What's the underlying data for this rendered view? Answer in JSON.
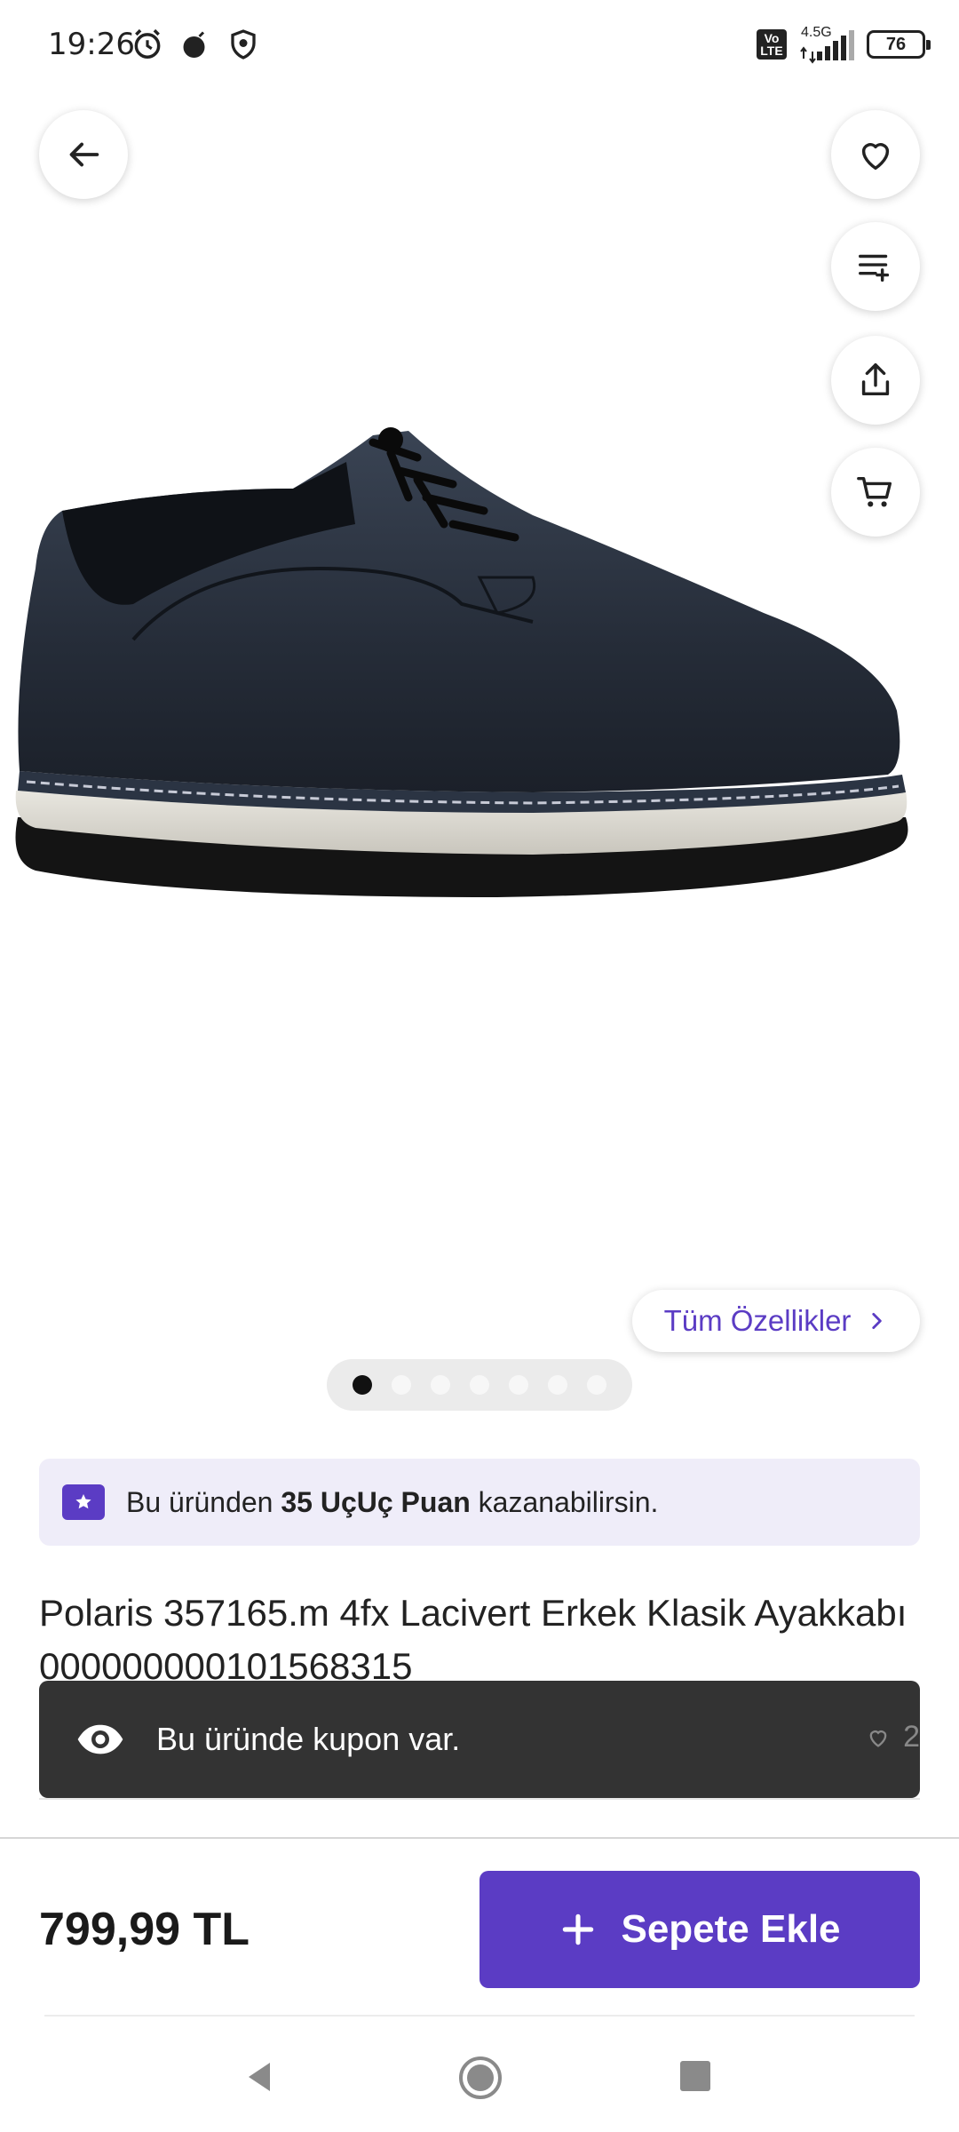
{
  "status_bar": {
    "time": "19:26",
    "network": "4.5G",
    "volte": "Vo LTE",
    "battery": "76"
  },
  "actions": {
    "back_icon": "arrow-left-icon",
    "favorite_icon": "heart-icon",
    "list_icon": "playlist-add-icon",
    "share_icon": "share-icon",
    "cart_icon": "cart-icon"
  },
  "gallery": {
    "all_features_label": "Tüm Özellikler",
    "page_count": 7,
    "active_page": 1
  },
  "points_banner": {
    "prefix": "Bu üründen",
    "highlight": "35 UçUç Puan",
    "suffix": "kazanabilirsin."
  },
  "product": {
    "title": "Polaris 357165.m 4fx Lacivert Erkek Klasik Ayakkabı 000000000101568315",
    "price": "799,99 TL"
  },
  "toast": {
    "message": "Bu üründe kupon var.",
    "fav_count": "2"
  },
  "bottom_bar": {
    "add_to_cart_label": "Sepete Ekle"
  },
  "colors": {
    "accent": "#5b3cc4",
    "banner_bg": "#efedf9",
    "toast_bg": "#333333"
  }
}
